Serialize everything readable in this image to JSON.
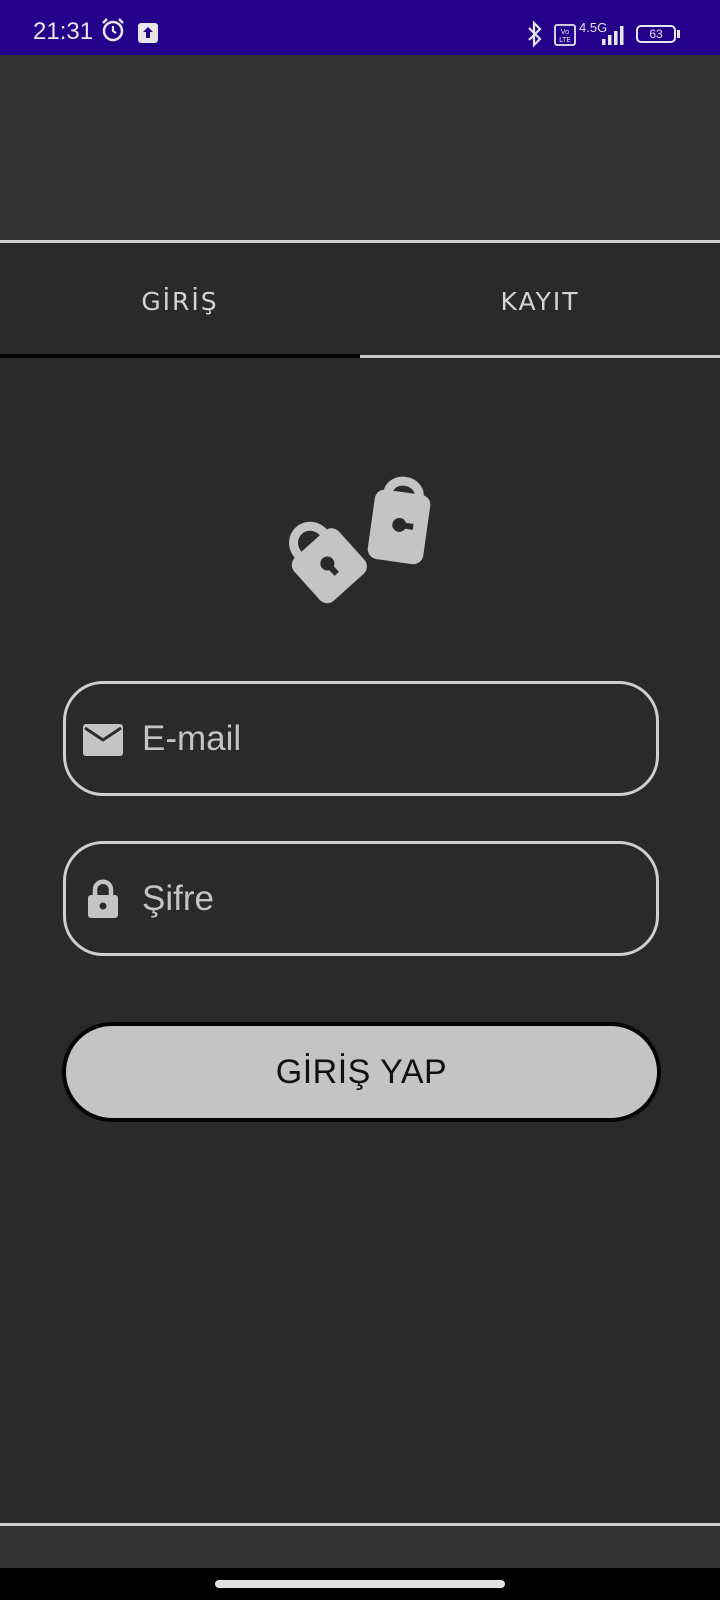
{
  "status_bar": {
    "time": "21:31",
    "network": "4.5G",
    "battery": "63",
    "icons": [
      "alarm-icon",
      "upload-icon",
      "bluetooth-icon",
      "volte-icon",
      "signal-icon",
      "battery-icon"
    ]
  },
  "tabs": [
    {
      "label": "GİRİŞ",
      "selected": true
    },
    {
      "label": "KAYIT",
      "selected": false
    }
  ],
  "logo": {
    "icon": "padlocks-icon"
  },
  "form": {
    "email": {
      "placeholder": "E-mail",
      "value": "",
      "icon": "mail-icon"
    },
    "password": {
      "placeholder": "Şifre",
      "value": "",
      "icon": "lock-icon"
    },
    "submit_label": "GİRİŞ YAP"
  },
  "colors": {
    "status_bar": "#24008b",
    "background": "#2a2a2a",
    "accent": "#c4c4c4"
  }
}
